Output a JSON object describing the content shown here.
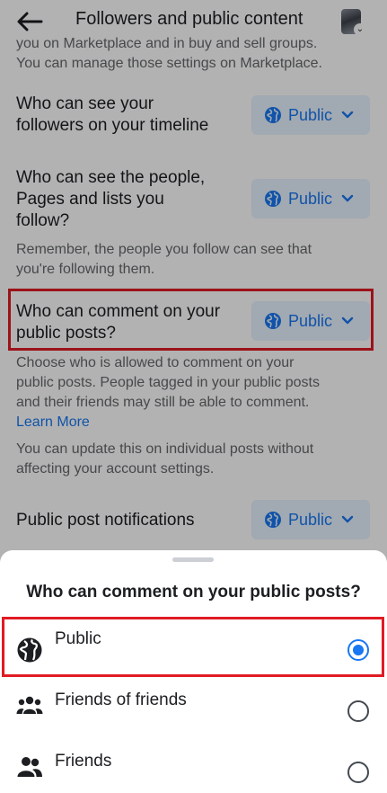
{
  "header": {
    "title": "Followers and public content"
  },
  "cut_text": {
    "line1": "you on Marketplace and in buy and sell groups.",
    "line2": "You can manage those settings on Marketplace."
  },
  "settings": [
    {
      "label_lines": [
        "Who can see your",
        "followers on your timeline"
      ],
      "value": "Public"
    },
    {
      "label_lines": [
        "Who can see the people,",
        "Pages and lists you",
        "follow?"
      ],
      "value": "Public",
      "hint_lines": [
        "Remember, the people you follow can see that",
        "you're following them."
      ]
    },
    {
      "label_lines": [
        "Who can comment on your",
        "public posts?"
      ],
      "value": "Public",
      "hint_lines": [
        "Choose who is allowed to comment on your",
        "public posts. People tagged in your public posts",
        "and their friends may still be able to comment."
      ],
      "link": "Learn More",
      "hint2_lines": [
        "You can update this on individual posts without",
        "affecting your account settings."
      ]
    },
    {
      "label_lines": [
        "Public post notifications"
      ],
      "value": "Public"
    }
  ],
  "sheet": {
    "title": "Who can comment on your public posts?",
    "options": [
      {
        "label": "Public",
        "icon": "globe-icon",
        "selected": true
      },
      {
        "label": "Friends of friends",
        "icon": "friends-of-friends-icon",
        "selected": false
      },
      {
        "label": "Friends",
        "icon": "friends-icon",
        "selected": false
      }
    ]
  },
  "colors": {
    "accent": "#1877f2",
    "pill_bg": "#e7f3ff",
    "highlight": "#e01b24",
    "secondary_text": "#65676b"
  }
}
